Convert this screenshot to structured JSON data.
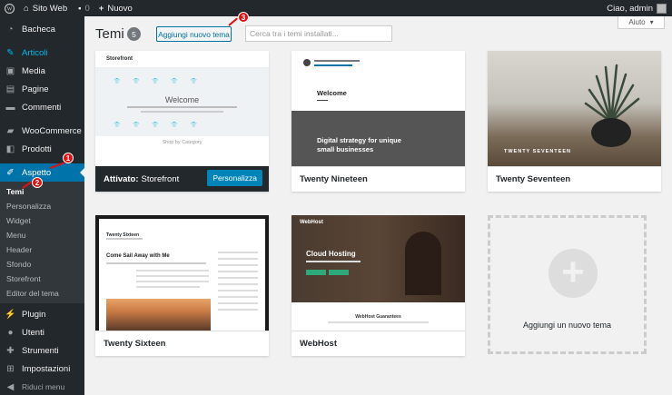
{
  "adminbar": {
    "site_name": "Sito Web",
    "comments_count": "0",
    "new_label": "Nuovo",
    "greeting": "Ciao, admin"
  },
  "sidebar": {
    "items": [
      {
        "label": "Bacheca",
        "icon": "dashboard-icon"
      },
      {
        "label": "Articoli",
        "icon": "pin-icon"
      },
      {
        "label": "Media",
        "icon": "media-icon"
      },
      {
        "label": "Pagine",
        "icon": "page-icon"
      },
      {
        "label": "Commenti",
        "icon": "comment-icon"
      },
      {
        "label": "WooCommerce",
        "icon": "woocommerce-icon"
      },
      {
        "label": "Prodotti",
        "icon": "product-icon"
      },
      {
        "label": "Aspetto",
        "icon": "brush-icon"
      },
      {
        "label": "Plugin",
        "icon": "plugin-icon"
      },
      {
        "label": "Utenti",
        "icon": "users-icon"
      },
      {
        "label": "Strumenti",
        "icon": "tools-icon"
      },
      {
        "label": "Impostazioni",
        "icon": "settings-icon"
      },
      {
        "label": "Riduci menu",
        "icon": "collapse-icon"
      }
    ],
    "submenu": [
      "Temi",
      "Personalizza",
      "Widget",
      "Menu",
      "Header",
      "Sfondo",
      "Storefront",
      "Editor del tema"
    ]
  },
  "page": {
    "title": "Temi",
    "theme_count": "5",
    "add_new_button": "Aggiungi nuovo tema",
    "search_placeholder": "Cerca tra i temi installati...",
    "help_label": "Aiuto"
  },
  "themes": {
    "storefront": {
      "active_prefix": "Attivato:",
      "name": "Storefront",
      "customize": "Personalizza",
      "logo": "Storefront",
      "welcome": "Welcome",
      "shop": "Shop by Category"
    },
    "twentynineteen": {
      "name": "Twenty Nineteen",
      "welcome": "Welcome",
      "headline": "Digital strategy for unique small businesses"
    },
    "twentyseventeen": {
      "name": "Twenty Seventeen",
      "banner": "TWENTY SEVENTEEN"
    },
    "twentysixteen": {
      "name": "Twenty Sixteen",
      "site": "Twenty Sixteen",
      "post": "Come Sail Away with Me"
    },
    "webhost": {
      "name": "WebHost",
      "logo": "WebHost",
      "headline": "Cloud Hosting",
      "guarantees": "WebHost Guarantees"
    },
    "add_new_label": "Aggiungi un nuovo tema"
  },
  "annotations": [
    "1",
    "2",
    "3"
  ],
  "colors": {
    "accent": "#0073aa",
    "adminbar": "#23282d",
    "badge": "#dd1111"
  }
}
